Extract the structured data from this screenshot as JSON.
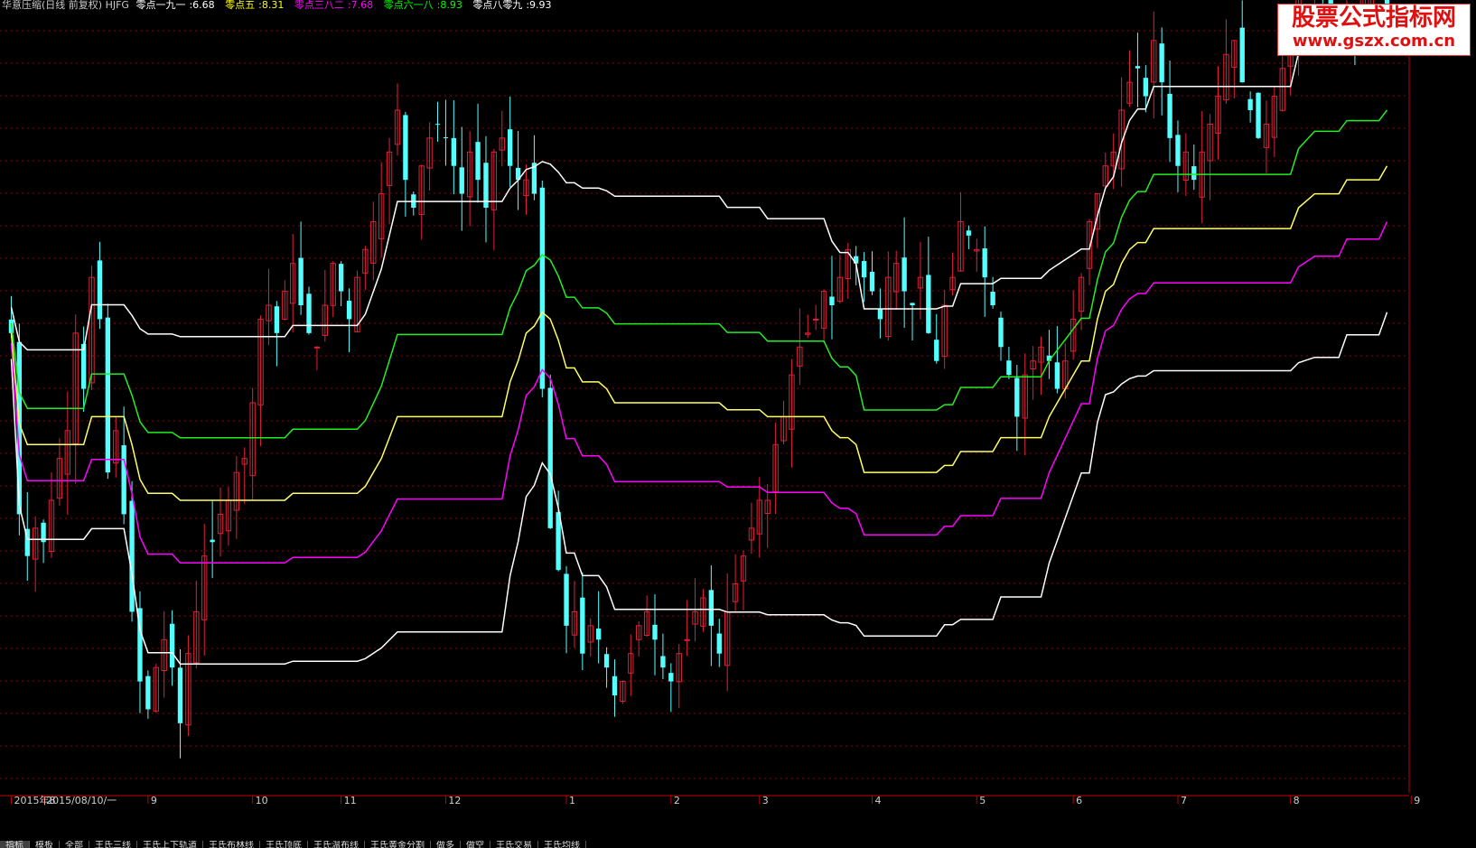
{
  "header": {
    "title": "华意压缩(日线 前复权) HJFG",
    "indicators": [
      {
        "name": "零点一九一",
        "value": "6.68",
        "color": "#ffffff"
      },
      {
        "name": "零点五",
        "value": "8.31",
        "color": "#ffff00"
      },
      {
        "name": "零点三八二",
        "value": "7.68",
        "color": "#ff00ff"
      },
      {
        "name": "零点六一八",
        "value": "8.93",
        "color": "#00ff00"
      },
      {
        "name": "零点八零九",
        "value": "9.93",
        "color": "#ffffff"
      }
    ]
  },
  "watermark": {
    "title": "股票公式指标网",
    "url": "www.gszx.com.cn"
  },
  "colors": {
    "up": "#e0203a",
    "down": "#54ffff",
    "grid": "#8b0000",
    "axis": "#c00000",
    "l191": "#ffffff",
    "l382": "#ff00ff",
    "l500": "#ffff66",
    "l618": "#22ee22",
    "l809": "#ffffff",
    "gray": "#c0c0c0"
  },
  "tabs": [
    "指标",
    "模板",
    "全部",
    "王氏三线",
    "王氏上下轨道",
    "王氏布林线",
    "王氏顶底",
    "王氏温布线",
    "王氏黄金分割",
    "做多",
    "做空",
    "王氏交易",
    "王氏均线"
  ],
  "chart_data": {
    "type": "candlestick",
    "title": "华意压缩(日线 前复权) HJFG",
    "ylim": [
      5.2,
      10.8
    ],
    "x_ticks": [
      {
        "label": "2015年8",
        "i": 0
      },
      {
        "label": "2015/08/10/一",
        "i": 4
      },
      {
        "label": "9",
        "i": 17
      },
      {
        "label": "10",
        "i": 30
      },
      {
        "label": "11",
        "i": 41
      },
      {
        "label": "12",
        "i": 54
      },
      {
        "label": "1",
        "i": 69
      },
      {
        "label": "2",
        "i": 82
      },
      {
        "label": "3",
        "i": 93
      },
      {
        "label": "4",
        "i": 107
      },
      {
        "label": "5",
        "i": 120
      },
      {
        "label": "6",
        "i": 132
      },
      {
        "label": "7",
        "i": 145
      },
      {
        "label": "8",
        "i": 159
      },
      {
        "label": "9",
        "i": 174
      }
    ],
    "closes": [
      8.5,
      7.2,
      6.9,
      7.1,
      7.0,
      7.3,
      7.6,
      7.8,
      8.5,
      8.1,
      8.9,
      8.6,
      7.5,
      7.8,
      7.2,
      6.5,
      6.0,
      5.8,
      6.1,
      6.3,
      6.1,
      5.7,
      6.2,
      6.5,
      6.9,
      7.0,
      7.2,
      7.3,
      7.5,
      7.6,
      8.0,
      8.6,
      8.7,
      8.5,
      8.8,
      9.0,
      8.7,
      8.5,
      8.4,
      8.7,
      9.0,
      8.8,
      8.6,
      8.9,
      9.1,
      9.3,
      9.5,
      9.8,
      10.1,
      9.6,
      9.4,
      9.7,
      9.9,
      10.0,
      9.9,
      9.7,
      9.5,
      9.8,
      9.6,
      9.4,
      9.8,
      9.9,
      9.7,
      9.6,
      9.6,
      9.5,
      8.1,
      7.1,
      6.8,
      6.4,
      6.5,
      6.2,
      6.4,
      6.3,
      6.1,
      5.9,
      6.0,
      6.2,
      6.4,
      6.5,
      6.3,
      6.1,
      6.0,
      6.2,
      6.3,
      6.5,
      6.6,
      6.4,
      6.2,
      6.5,
      6.7,
      6.9,
      7.1,
      7.3,
      7.3,
      7.7,
      7.9,
      8.2,
      8.4,
      8.5,
      8.6,
      8.8,
      8.7,
      8.9,
      9.1,
      9.0,
      8.9,
      8.8,
      8.6,
      8.9,
      9.0,
      8.8,
      8.7,
      8.9,
      8.5,
      8.3,
      8.7,
      8.9,
      9.3,
      9.2,
      9.1,
      8.9,
      8.7,
      8.4,
      8.2,
      7.9,
      8.2,
      8.3,
      8.4,
      8.3,
      8.1,
      8.3,
      8.6,
      8.9,
      9.3,
      9.5,
      9.7,
      9.8,
      10.1,
      10.3,
      10.4,
      10.2,
      10.6,
      10.3,
      9.9,
      9.7,
      9.8,
      9.6,
      9.8,
      10.0,
      10.2,
      10.5,
      10.6,
      10.3,
      10.1,
      9.9,
      10.0,
      10.2,
      10.4,
      10.5,
      10.9,
      11.0,
      11.1,
      10.9,
      10.7,
      10.6,
      10.8,
      10.7,
      10.9,
      11.0,
      11.1,
      10.8
    ]
  }
}
